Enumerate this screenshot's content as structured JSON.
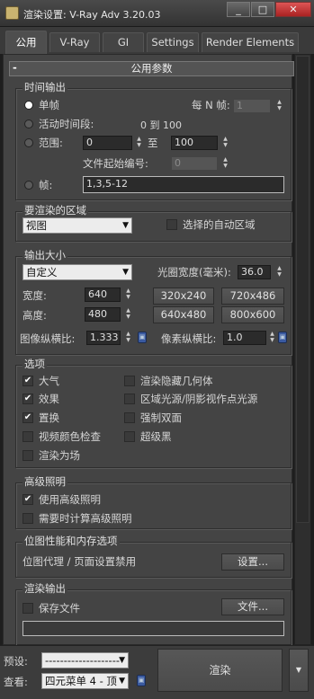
{
  "window": {
    "title": "渲染设置: V-Ray Adv 3.20.03",
    "buttons": {
      "minimize": "_",
      "maximize": "□",
      "close": "✕"
    }
  },
  "tabs": [
    "公用",
    "V-Ray",
    "GI",
    "Settings",
    "Render Elements"
  ],
  "rollout": {
    "collapse": "-",
    "title": "公用参数"
  },
  "time_output": {
    "label": "时间输出",
    "single": "单帧",
    "every_n": "每 N 帧:",
    "every_n_value": "1",
    "active_segment": "活动时间段:",
    "active_range": "0 到 100",
    "range": "范围:",
    "range_from": "0",
    "range_to_label": "至",
    "range_to": "100",
    "file_start": "文件起始编号:",
    "file_start_value": "0",
    "frames": "帧:",
    "frames_value": "1,3,5-12"
  },
  "area": {
    "label": "要渲染的区域",
    "value": "视图",
    "auto_region": "选择的自动区域"
  },
  "output_size": {
    "label": "输出大小",
    "preset": "自定义",
    "aperture_label": "光圈宽度(毫米):",
    "aperture": "36.0",
    "width_label": "宽度:",
    "width": "640",
    "height_label": "高度:",
    "height": "480",
    "presets": [
      "320x240",
      "720x486",
      "640x480",
      "800x600"
    ],
    "image_aspect_label": "图像纵横比:",
    "image_aspect": "1.333",
    "pixel_aspect_label": "像素纵横比:",
    "pixel_aspect": "1.0"
  },
  "options": {
    "label": "选项",
    "items": [
      {
        "label": "大气",
        "checked": true
      },
      {
        "label": "渲染隐藏几何体",
        "checked": false
      },
      {
        "label": "效果",
        "checked": true
      },
      {
        "label": "区域光源/阴影视作点光源",
        "checked": false
      },
      {
        "label": "置换",
        "checked": true
      },
      {
        "label": "强制双面",
        "checked": false
      },
      {
        "label": "视频颜色检查",
        "checked": false
      },
      {
        "label": "超级黑",
        "checked": false
      },
      {
        "label": "渲染为场",
        "checked": false
      }
    ]
  },
  "advanced_lighting": {
    "label": "高级照明",
    "use": "使用高级照明",
    "use_checked": true,
    "compute": "需要时计算高级照明",
    "compute_checked": false
  },
  "bitmap": {
    "label": "位图性能和内存选项",
    "text": "位图代理 / 页面设置禁用",
    "button": "设置..."
  },
  "render_output": {
    "label": "渲染输出",
    "save_file": "保存文件",
    "save_checked": false,
    "files_button": "文件..."
  },
  "bottom": {
    "preset_label": "预设:",
    "preset_value": "--------------------",
    "view_label": "查看:",
    "view_value": "四元菜单 4 - 顶",
    "render_button": "渲染",
    "more": "▼"
  }
}
